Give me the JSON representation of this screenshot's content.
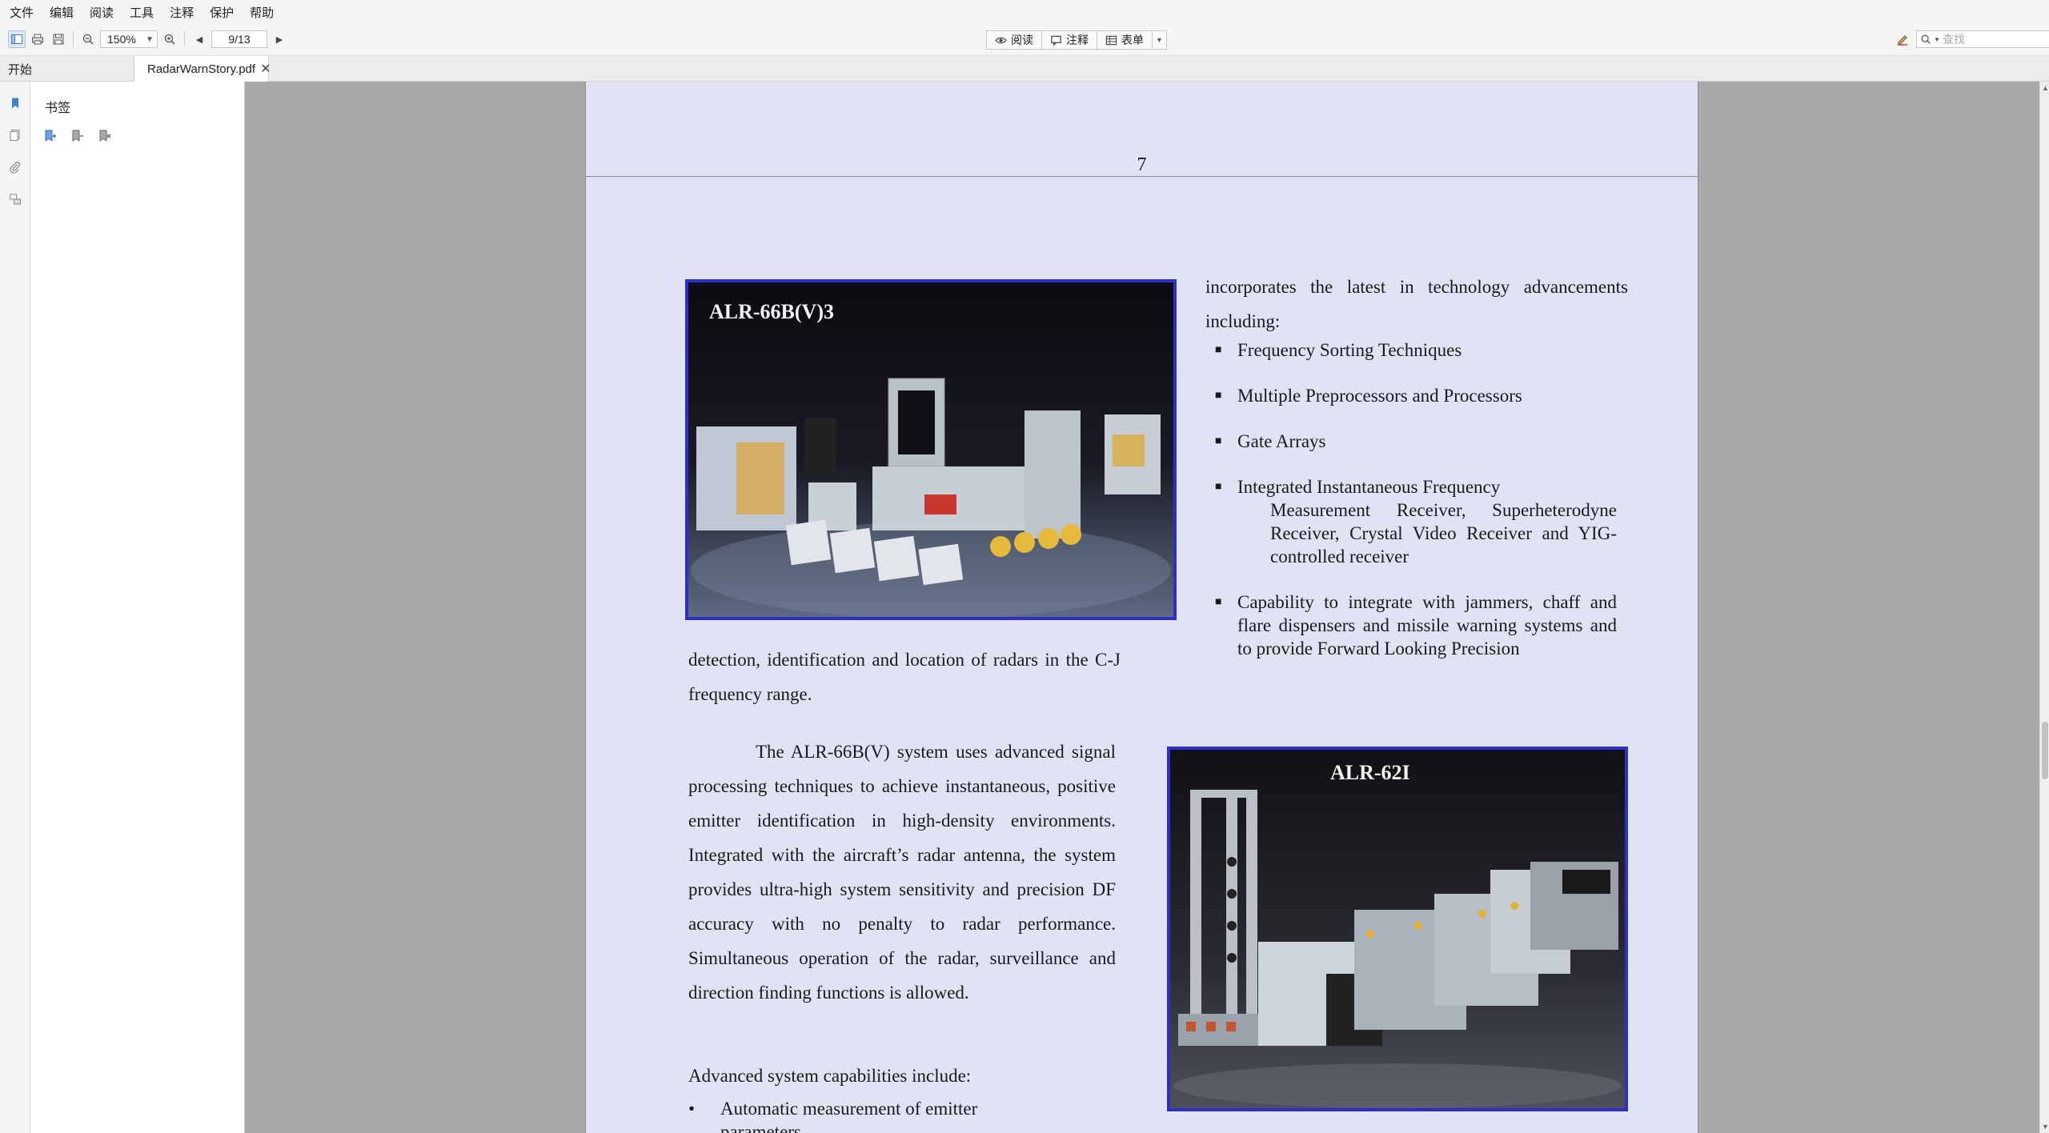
{
  "menu": [
    "文件",
    "编辑",
    "阅读",
    "工具",
    "注释",
    "保护",
    "帮助"
  ],
  "toolbar": {
    "zoom": "150%",
    "page": "9/13",
    "modes": {
      "read": "阅读",
      "annotate": "注释",
      "form": "表单"
    },
    "search_placeholder": "查找"
  },
  "tabs": {
    "home": "开始",
    "document": "RadarWarnStory.pdf"
  },
  "sidebar": {
    "title": "书签"
  },
  "document": {
    "prev_page_number": "7",
    "photo1_caption": "ALR-66B(V)3",
    "photo2_caption": "ALR-62I",
    "right_intro": "incorporates the latest in technology advancements including:",
    "features": [
      {
        "line1": "Frequency Sorting Techniques",
        "cont": ""
      },
      {
        "line1": "Multiple Preprocessors and Processors",
        "cont": ""
      },
      {
        "line1": "Gate Arrays",
        "cont": ""
      },
      {
        "line1": "Integrated Instantaneous Frequency",
        "cont": "Measurement Receiver, Superheterodyne Receiver, Crystal Video Receiver and YIG-controlled receiver"
      },
      {
        "line1": "Capability to integrate with jammers, chaff and flare dispensers and missile warning systems and to provide Forward Looking Precision",
        "cont": ""
      }
    ],
    "para_detection": "detection, identification and location of radars in the C-J frequency range.",
    "para_system": "The ALR-66B(V) system uses advanced signal processing techniques to achieve instantaneous, positive emitter identification in high-density environments. Integrated with the aircraft’s radar antenna, the system provides ultra-high system sensitivity and precision DF accuracy with no penalty to radar performance. Simultaneous operation  of the radar, surveillance and direction finding functions is allowed.",
    "capabilities_heading": "Advanced system capabilities include:",
    "capabilities": [
      "Automatic measurement of emitter parameters"
    ]
  },
  "colors": {
    "page_bg": "#dfe3f3",
    "photo_border": "#2e2ecb",
    "viewport_bg": "#a9a9a9"
  }
}
